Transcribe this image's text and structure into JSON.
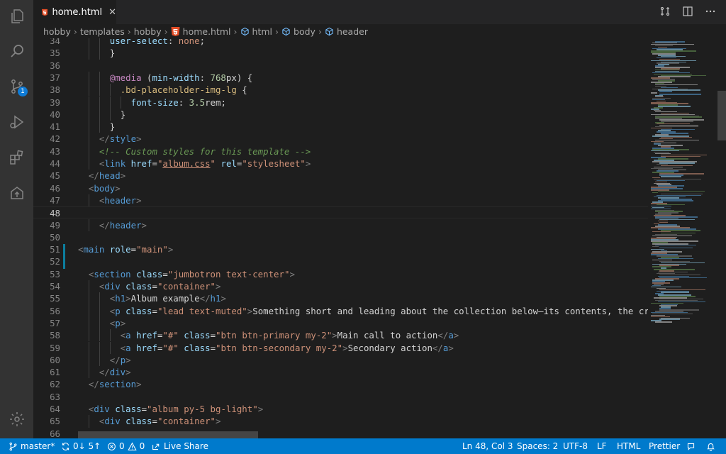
{
  "tab": {
    "label": "home.html",
    "close": "✕"
  },
  "breadcrumbs": [
    {
      "label": "hobby",
      "icon": "none"
    },
    {
      "label": "templates",
      "icon": "none"
    },
    {
      "label": "hobby",
      "icon": "none"
    },
    {
      "label": "home.html",
      "icon": "html5-icon"
    },
    {
      "label": "html",
      "icon": "cube-icon"
    },
    {
      "label": "body",
      "icon": "cube-icon"
    },
    {
      "label": "header",
      "icon": "cube-icon"
    }
  ],
  "activity": {
    "source_control_badge": "1"
  },
  "editor": {
    "current_line": 48,
    "lines": [
      {
        "n": "34",
        "indent": 6,
        "tokens": [
          [
            "prop",
            "user-select"
          ],
          [
            "tx",
            ": "
          ],
          [
            "sv",
            "none"
          ],
          [
            "tx",
            ";"
          ]
        ]
      },
      {
        "n": "35",
        "indent": 6,
        "tokens": [
          [
            "tx",
            "}"
          ]
        ]
      },
      {
        "n": "36",
        "indent": 0,
        "tokens": []
      },
      {
        "n": "37",
        "indent": 6,
        "tokens": [
          [
            "kw",
            "@media"
          ],
          [
            "tx",
            " ("
          ],
          [
            "prop",
            "min-width"
          ],
          [
            "tx",
            ": "
          ],
          [
            "num",
            "768"
          ],
          [
            "tx",
            "px) {"
          ]
        ]
      },
      {
        "n": "38",
        "indent": 8,
        "tokens": [
          [
            "sel",
            ".bd-placeholder-img-lg"
          ],
          [
            "tx",
            " {"
          ]
        ]
      },
      {
        "n": "39",
        "indent": 10,
        "tokens": [
          [
            "prop",
            "font-size"
          ],
          [
            "tx",
            ": "
          ],
          [
            "num",
            "3.5"
          ],
          [
            "tx",
            "rem;"
          ]
        ]
      },
      {
        "n": "40",
        "indent": 8,
        "tokens": [
          [
            "tx",
            "}"
          ]
        ]
      },
      {
        "n": "41",
        "indent": 6,
        "tokens": [
          [
            "tx",
            "}"
          ]
        ]
      },
      {
        "n": "42",
        "indent": 4,
        "tokens": [
          [
            "tag",
            "</"
          ],
          [
            "tn",
            "style"
          ],
          [
            "tag",
            ">"
          ]
        ]
      },
      {
        "n": "43",
        "indent": 4,
        "tokens": [
          [
            "cm",
            "<!-- Custom styles for this template -->"
          ]
        ]
      },
      {
        "n": "44",
        "indent": 4,
        "tokens": [
          [
            "tag",
            "<"
          ],
          [
            "tn",
            "link"
          ],
          [
            "tx",
            " "
          ],
          [
            "at",
            "href"
          ],
          [
            "tx",
            "="
          ],
          [
            "sv",
            "\""
          ],
          [
            "sv ul",
            "album.css"
          ],
          [
            "sv",
            "\""
          ],
          [
            "tx",
            " "
          ],
          [
            "at",
            "rel"
          ],
          [
            "tx",
            "="
          ],
          [
            "sv",
            "\"stylesheet\""
          ],
          [
            "tag",
            ">"
          ]
        ]
      },
      {
        "n": "45",
        "indent": 2,
        "tokens": [
          [
            "tag",
            "</"
          ],
          [
            "tn",
            "head"
          ],
          [
            "tag",
            ">"
          ]
        ]
      },
      {
        "n": "46",
        "indent": 2,
        "tokens": [
          [
            "tag",
            "<"
          ],
          [
            "tn",
            "body"
          ],
          [
            "tag",
            ">"
          ]
        ]
      },
      {
        "n": "47",
        "indent": 4,
        "tokens": [
          [
            "tag",
            "<"
          ],
          [
            "tn",
            "header"
          ],
          [
            "tag",
            ">"
          ]
        ]
      },
      {
        "n": "48",
        "indent": 0,
        "tokens": []
      },
      {
        "n": "49",
        "indent": 4,
        "tokens": [
          [
            "tag",
            "</"
          ],
          [
            "tn",
            "header"
          ],
          [
            "tag",
            ">"
          ]
        ]
      },
      {
        "n": "50",
        "indent": 0,
        "tokens": []
      },
      {
        "n": "51",
        "indent": 0,
        "tokens": [
          [
            "tag",
            "<"
          ],
          [
            "tn",
            "main"
          ],
          [
            "tx",
            " "
          ],
          [
            "at",
            "role"
          ],
          [
            "tx",
            "="
          ],
          [
            "sv",
            "\"main\""
          ],
          [
            "tag",
            ">"
          ]
        ]
      },
      {
        "n": "52",
        "indent": 0,
        "tokens": []
      },
      {
        "n": "53",
        "indent": 2,
        "tokens": [
          [
            "tag",
            "<"
          ],
          [
            "tn",
            "section"
          ],
          [
            "tx",
            " "
          ],
          [
            "at",
            "class"
          ],
          [
            "tx",
            "="
          ],
          [
            "sv",
            "\"jumbotron text-center\""
          ],
          [
            "tag",
            ">"
          ]
        ]
      },
      {
        "n": "54",
        "indent": 4,
        "tokens": [
          [
            "tag",
            "<"
          ],
          [
            "tn",
            "div"
          ],
          [
            "tx",
            " "
          ],
          [
            "at",
            "class"
          ],
          [
            "tx",
            "="
          ],
          [
            "sv",
            "\"container\""
          ],
          [
            "tag",
            ">"
          ]
        ]
      },
      {
        "n": "55",
        "indent": 6,
        "tokens": [
          [
            "tag",
            "<"
          ],
          [
            "tn",
            "h1"
          ],
          [
            "tag",
            ">"
          ],
          [
            "tx",
            "Album example"
          ],
          [
            "tag",
            "</"
          ],
          [
            "tn",
            "h1"
          ],
          [
            "tag",
            ">"
          ]
        ]
      },
      {
        "n": "56",
        "indent": 6,
        "tokens": [
          [
            "tag",
            "<"
          ],
          [
            "tn",
            "p"
          ],
          [
            "tx",
            " "
          ],
          [
            "at",
            "class"
          ],
          [
            "tx",
            "="
          ],
          [
            "sv",
            "\"lead text-muted\""
          ],
          [
            "tag",
            ">"
          ],
          [
            "tx",
            "Something short and leading about the collection below—its contents, the creator, e"
          ]
        ]
      },
      {
        "n": "57",
        "indent": 6,
        "tokens": [
          [
            "tag",
            "<"
          ],
          [
            "tn",
            "p"
          ],
          [
            "tag",
            ">"
          ]
        ]
      },
      {
        "n": "58",
        "indent": 8,
        "tokens": [
          [
            "tag",
            "<"
          ],
          [
            "tn",
            "a"
          ],
          [
            "tx",
            " "
          ],
          [
            "at",
            "href"
          ],
          [
            "tx",
            "="
          ],
          [
            "sv",
            "\"#\""
          ],
          [
            "tx",
            " "
          ],
          [
            "at",
            "class"
          ],
          [
            "tx",
            "="
          ],
          [
            "sv",
            "\"btn btn-primary my-2\""
          ],
          [
            "tag",
            ">"
          ],
          [
            "tx",
            "Main call to action"
          ],
          [
            "tag",
            "</"
          ],
          [
            "tn",
            "a"
          ],
          [
            "tag",
            ">"
          ]
        ]
      },
      {
        "n": "59",
        "indent": 8,
        "tokens": [
          [
            "tag",
            "<"
          ],
          [
            "tn",
            "a"
          ],
          [
            "tx",
            " "
          ],
          [
            "at",
            "href"
          ],
          [
            "tx",
            "="
          ],
          [
            "sv",
            "\"#\""
          ],
          [
            "tx",
            " "
          ],
          [
            "at",
            "class"
          ],
          [
            "tx",
            "="
          ],
          [
            "sv",
            "\"btn btn-secondary my-2\""
          ],
          [
            "tag",
            ">"
          ],
          [
            "tx",
            "Secondary action"
          ],
          [
            "tag",
            "</"
          ],
          [
            "tn",
            "a"
          ],
          [
            "tag",
            ">"
          ]
        ]
      },
      {
        "n": "60",
        "indent": 6,
        "tokens": [
          [
            "tag",
            "</"
          ],
          [
            "tn",
            "p"
          ],
          [
            "tag",
            ">"
          ]
        ]
      },
      {
        "n": "61",
        "indent": 4,
        "tokens": [
          [
            "tag",
            "</"
          ],
          [
            "tn",
            "div"
          ],
          [
            "tag",
            ">"
          ]
        ]
      },
      {
        "n": "62",
        "indent": 2,
        "tokens": [
          [
            "tag",
            "</"
          ],
          [
            "tn",
            "section"
          ],
          [
            "tag",
            ">"
          ]
        ]
      },
      {
        "n": "63",
        "indent": 0,
        "tokens": []
      },
      {
        "n": "64",
        "indent": 2,
        "tokens": [
          [
            "tag",
            "<"
          ],
          [
            "tn",
            "div"
          ],
          [
            "tx",
            " "
          ],
          [
            "at",
            "class"
          ],
          [
            "tx",
            "="
          ],
          [
            "sv",
            "\"album py-5 bg-light\""
          ],
          [
            "tag",
            ">"
          ]
        ]
      },
      {
        "n": "65",
        "indent": 4,
        "tokens": [
          [
            "tag",
            "<"
          ],
          [
            "tn",
            "div"
          ],
          [
            "tx",
            " "
          ],
          [
            "at",
            "class"
          ],
          [
            "tx",
            "="
          ],
          [
            "sv",
            "\"container\""
          ],
          [
            "tag",
            ">"
          ]
        ]
      },
      {
        "n": "66",
        "indent": 0,
        "tokens": []
      }
    ]
  },
  "status": {
    "branch": "master*",
    "sync": "0↓ 5↑",
    "errors": "0",
    "warnings": "0",
    "live_share": "Live Share",
    "position": "Ln 48, Col 3",
    "spaces": "Spaces: 2",
    "encoding": "UTF-8",
    "eol": "LF",
    "language": "HTML",
    "formatter": "Prettier"
  },
  "colors": {
    "accent": "#007acc",
    "editor_bg": "#1e1e1e",
    "activity_bg": "#333333",
    "html_icon": "#e44d26"
  }
}
